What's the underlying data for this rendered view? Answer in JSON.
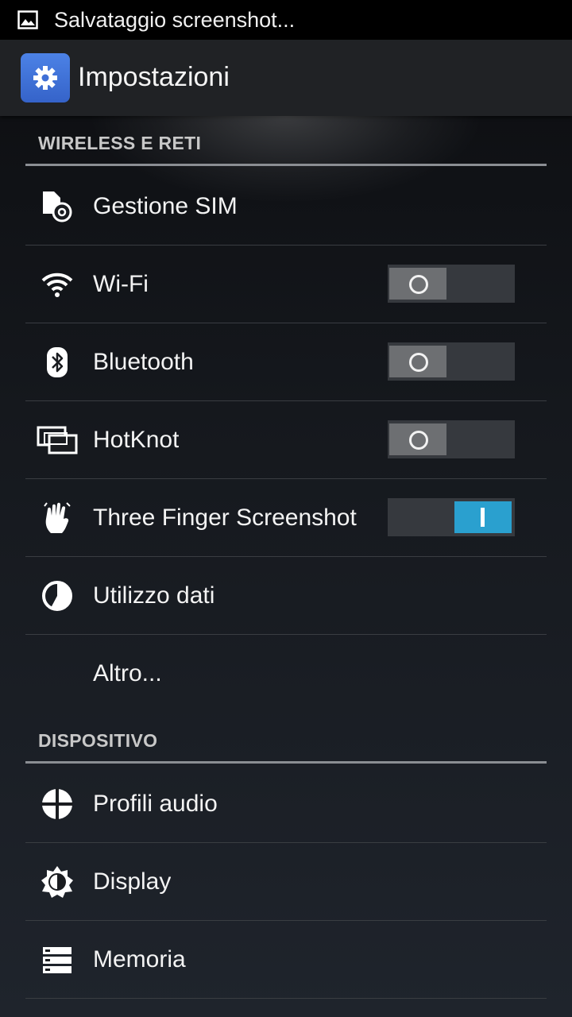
{
  "status_bar": {
    "text": "Salvataggio screenshot...",
    "icon": "image-icon"
  },
  "action_bar": {
    "title": "Impostazioni",
    "icon": "settings-gear-icon",
    "icon_color": "#3f74db"
  },
  "sections": [
    {
      "header": "WIRELESS E RETI",
      "items": [
        {
          "label": "Gestione SIM",
          "icon": "sim-management-icon"
        },
        {
          "label": "Wi-Fi",
          "icon": "wifi-icon",
          "switch": "off"
        },
        {
          "label": "Bluetooth",
          "icon": "bluetooth-icon",
          "switch": "off"
        },
        {
          "label": "HotKnot",
          "icon": "hotknot-icon",
          "switch": "off"
        },
        {
          "label": "Three Finger Screenshot",
          "icon": "hand-gesture-icon",
          "switch": "on"
        },
        {
          "label": "Utilizzo dati",
          "icon": "data-usage-icon"
        },
        {
          "label": "Altro...",
          "icon": ""
        }
      ]
    },
    {
      "header": "DISPOSITIVO",
      "items": [
        {
          "label": "Profili audio",
          "icon": "audio-profiles-icon"
        },
        {
          "label": "Display",
          "icon": "display-brightness-icon"
        },
        {
          "label": "Memoria",
          "icon": "storage-icon"
        }
      ]
    }
  ],
  "colors": {
    "switch_on": "#2aa0cf",
    "switch_off_thumb": "#6d6f72",
    "switch_track": "#36393e"
  }
}
